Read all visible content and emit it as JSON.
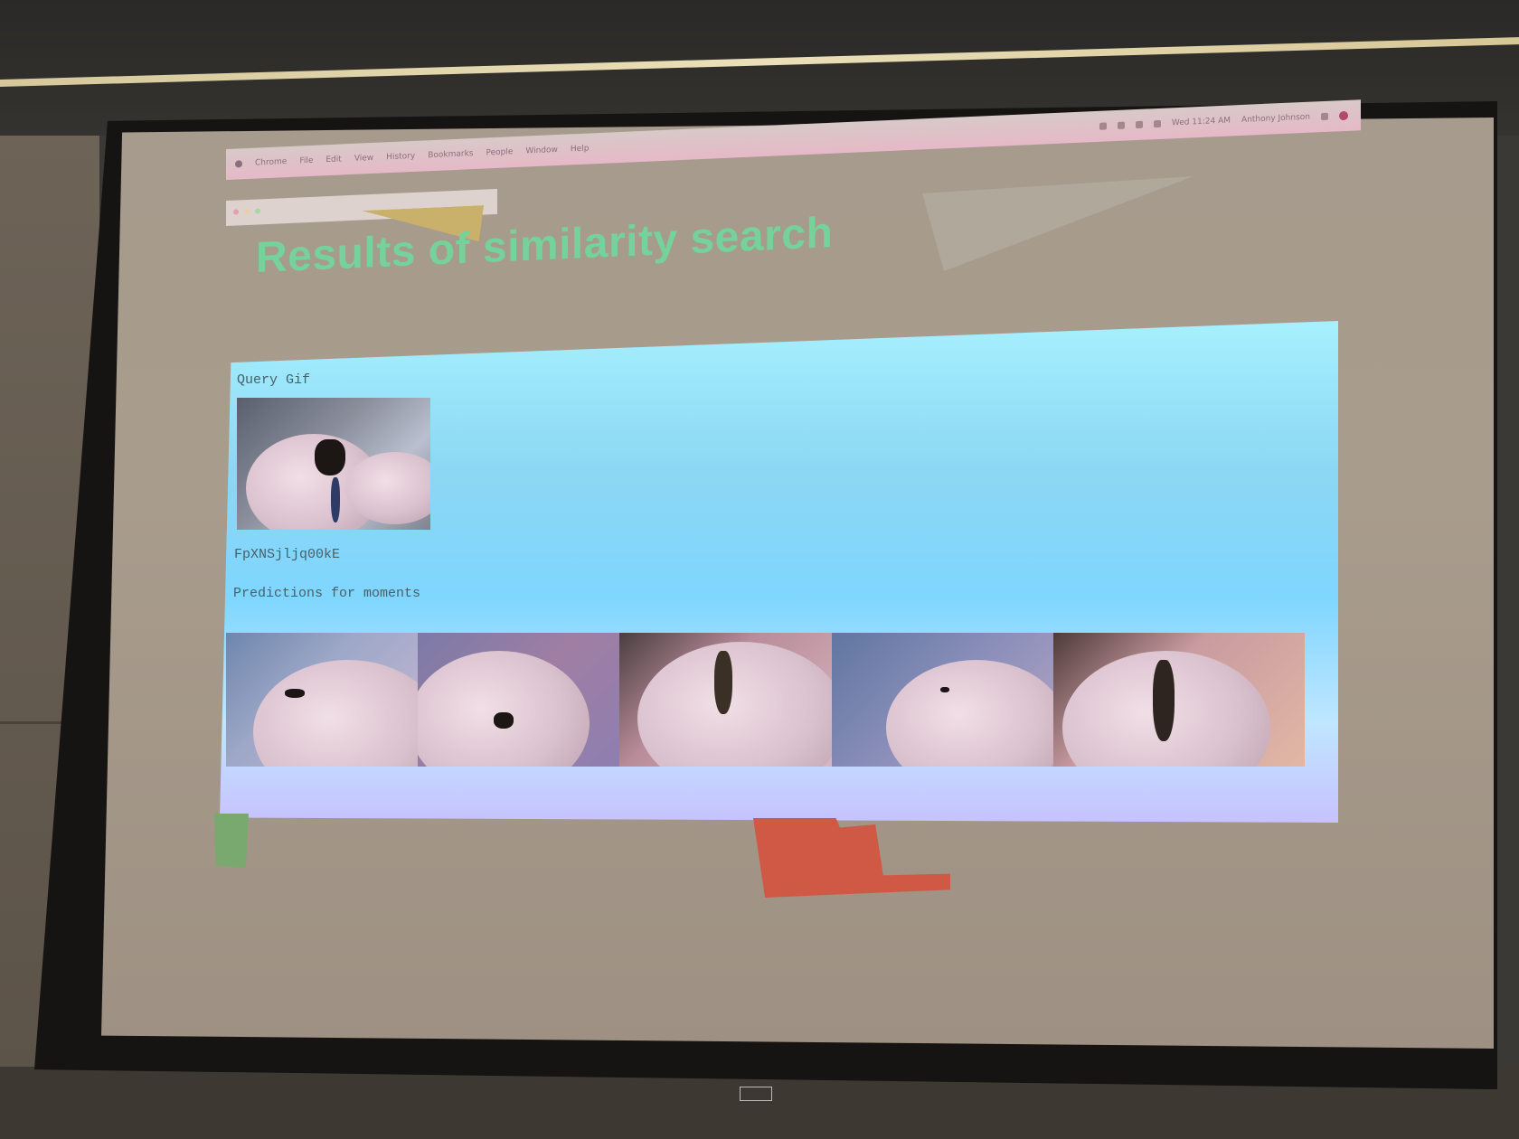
{
  "slide": {
    "title": "Results of similarity search"
  },
  "menubar": {
    "items": [
      "Chrome",
      "File",
      "Edit",
      "View",
      "History",
      "Bookmarks",
      "People",
      "Window",
      "Help"
    ],
    "clock": "Wed 11:24 AM",
    "user": "Anthony Johnson"
  },
  "panel": {
    "query_label": "Query Gif",
    "gif_id": "FpXNSjljq00kE",
    "predictions_label": "Predictions for moments"
  },
  "colors": {
    "title_green": "#74d29a",
    "panel_cyan": "#8cd7f3",
    "deco_red": "#cf5944",
    "deco_green": "#79a96e"
  }
}
